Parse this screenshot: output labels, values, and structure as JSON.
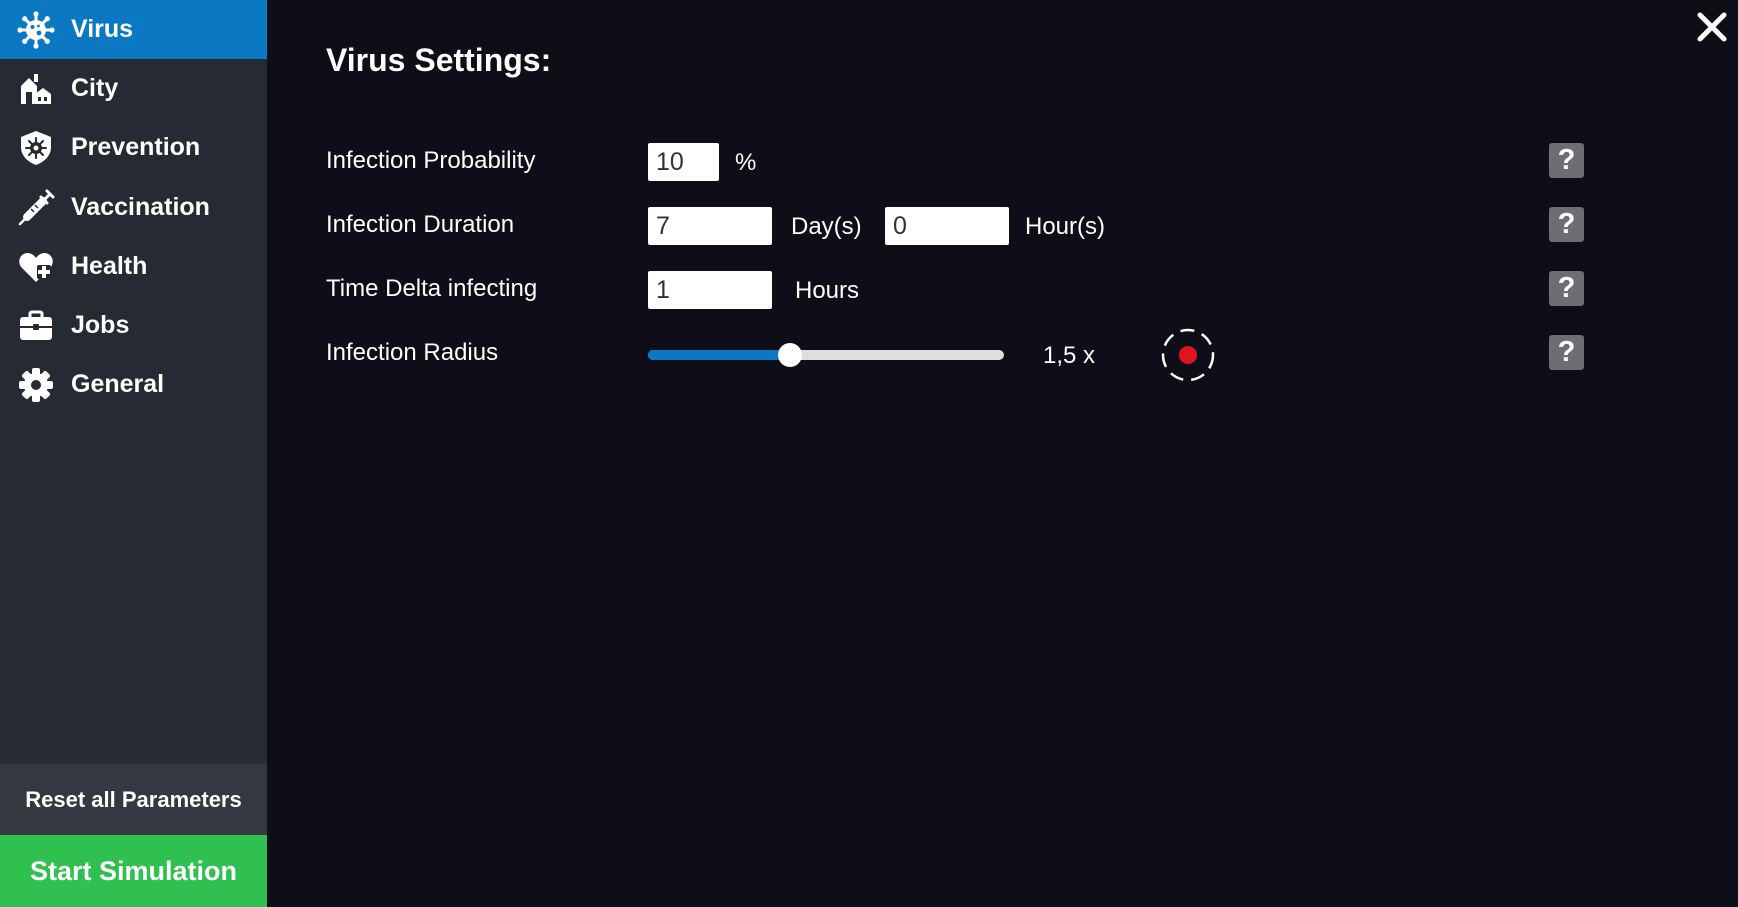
{
  "sidebar": {
    "items": [
      {
        "label": "Virus",
        "icon": "virus-icon",
        "active": true
      },
      {
        "label": "City",
        "icon": "city-icon",
        "active": false
      },
      {
        "label": "Prevention",
        "icon": "shield-virus-icon",
        "active": false
      },
      {
        "label": "Vaccination",
        "icon": "syringe-icon",
        "active": false
      },
      {
        "label": "Health",
        "icon": "heart-plus-icon",
        "active": false
      },
      {
        "label": "Jobs",
        "icon": "briefcase-icon",
        "active": false
      },
      {
        "label": "General",
        "icon": "gear-icon",
        "active": false
      }
    ],
    "reset_label": "Reset all Parameters",
    "start_label": "Start Simulation"
  },
  "main": {
    "title": "Virus Settings:",
    "help_label": "?",
    "rows": {
      "infection_probability": {
        "label": "Infection Probability",
        "value": "10",
        "unit": "%"
      },
      "infection_duration": {
        "label": "Infection Duration",
        "days_value": "7",
        "days_unit": "Day(s)",
        "hours_value": "0",
        "hours_unit": "Hour(s)"
      },
      "time_delta": {
        "label": "Time Delta infecting",
        "value": "1",
        "unit": "Hours"
      },
      "infection_radius": {
        "label": "Infection Radius",
        "value_text": "1,5 x",
        "slider_fraction": 0.4
      }
    }
  },
  "colors": {
    "sidebar_bg": "#262a33",
    "active_bg": "#0a78c2",
    "main_bg": "#0d0e17",
    "start_green": "#2fc04f",
    "help_gray": "#6d6e71",
    "radius_dot": "#e0141e"
  }
}
